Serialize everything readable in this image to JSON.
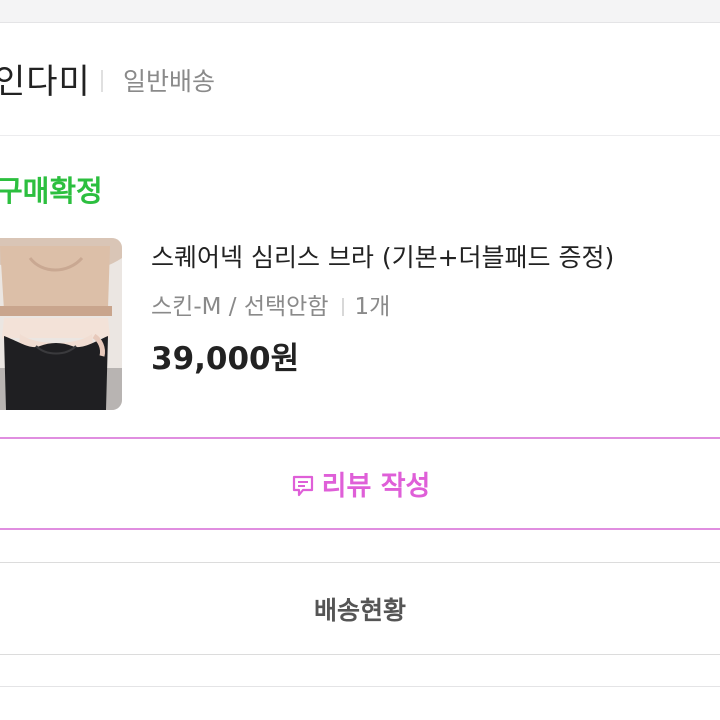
{
  "seller": {
    "name": "인다미",
    "shipping_type": "일반배송"
  },
  "order": {
    "status": "구매확정"
  },
  "product": {
    "name": "스퀘어넥 심리스 브라 (기본+더블패드 증정)",
    "option": "스킨-M / 선택안함",
    "quantity": "1개",
    "price": "39,000원"
  },
  "actions": {
    "review_label": "리뷰 작성",
    "delivery_label": "배송현황"
  },
  "colors": {
    "status": "#2cbf3f",
    "review": "#df5fd8",
    "review_border": "#e08ee0"
  }
}
